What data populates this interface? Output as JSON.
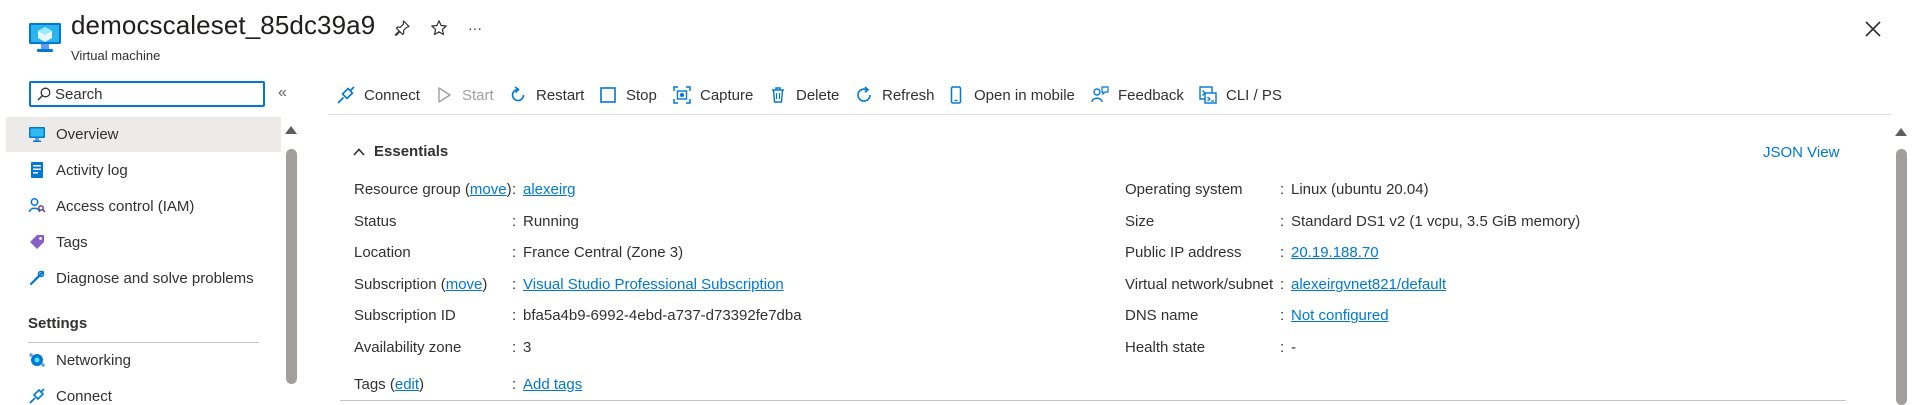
{
  "header": {
    "title": "democscaleset_85dc39a9",
    "subtitle": "Virtual machine",
    "icons": [
      "virtual-machine-icon",
      "pin-icon",
      "star-icon",
      "more-icon",
      "close-icon"
    ],
    "more_glyph": "···"
  },
  "sidebar": {
    "search_placeholder": "Search",
    "collapse_glyph": "«",
    "items": [
      {
        "label": "Overview",
        "icon": "overview-icon",
        "selected": true
      },
      {
        "label": "Activity log",
        "icon": "activity-log-icon"
      },
      {
        "label": "Access control (IAM)",
        "icon": "iam-icon"
      },
      {
        "label": "Tags",
        "icon": "tag-icon"
      },
      {
        "label": "Diagnose and solve problems",
        "icon": "wrench-icon"
      }
    ],
    "section_settings": "Settings",
    "settings_items": [
      {
        "label": "Networking",
        "icon": "networking-icon"
      },
      {
        "label": "Connect",
        "icon": "connect-icon"
      }
    ]
  },
  "toolbar": {
    "connect": "Connect",
    "start": "Start",
    "restart": "Restart",
    "stop": "Stop",
    "capture": "Capture",
    "delete": "Delete",
    "refresh": "Refresh",
    "open_in_mobile": "Open in mobile",
    "feedback": "Feedback",
    "cli_ps": "CLI / PS"
  },
  "essentials": {
    "heading": "Essentials",
    "json_view": "JSON View",
    "colon": ":",
    "left": {
      "resource_group_label": "Resource group",
      "move_link": "move",
      "resource_group_value": "alexeirg",
      "status_label": "Status",
      "status_value": "Running",
      "location_label": "Location",
      "location_value": "France Central (Zone 3)",
      "subscription_label": "Subscription",
      "subscription_value": "Visual Studio Professional Subscription",
      "subscription_id_label": "Subscription ID",
      "subscription_id_value": "bfa5a4b9-6992-4ebd-a737-d73392fe7dba",
      "availability_zone_label": "Availability zone",
      "availability_zone_value": "3",
      "tags_label": "Tags",
      "edit_link": "edit",
      "tags_value": "Add tags"
    },
    "right": {
      "os_label": "Operating system",
      "os_value": "Linux (ubuntu 20.04)",
      "size_label": "Size",
      "size_value": "Standard DS1 v2 (1 vcpu, 3.5 GiB memory)",
      "public_ip_label": "Public IP address",
      "public_ip_value": "20.19.188.70",
      "vnet_label": "Virtual network/subnet",
      "vnet_value": "alexeirgvnet821/default",
      "dns_label": "DNS name",
      "dns_value": "Not configured",
      "health_label": "Health state",
      "health_value": "-"
    }
  },
  "colors": {
    "accent": "#0078d4",
    "text": "#323130",
    "disabled": "#a19f9d",
    "selected_bg": "#edebe9"
  }
}
